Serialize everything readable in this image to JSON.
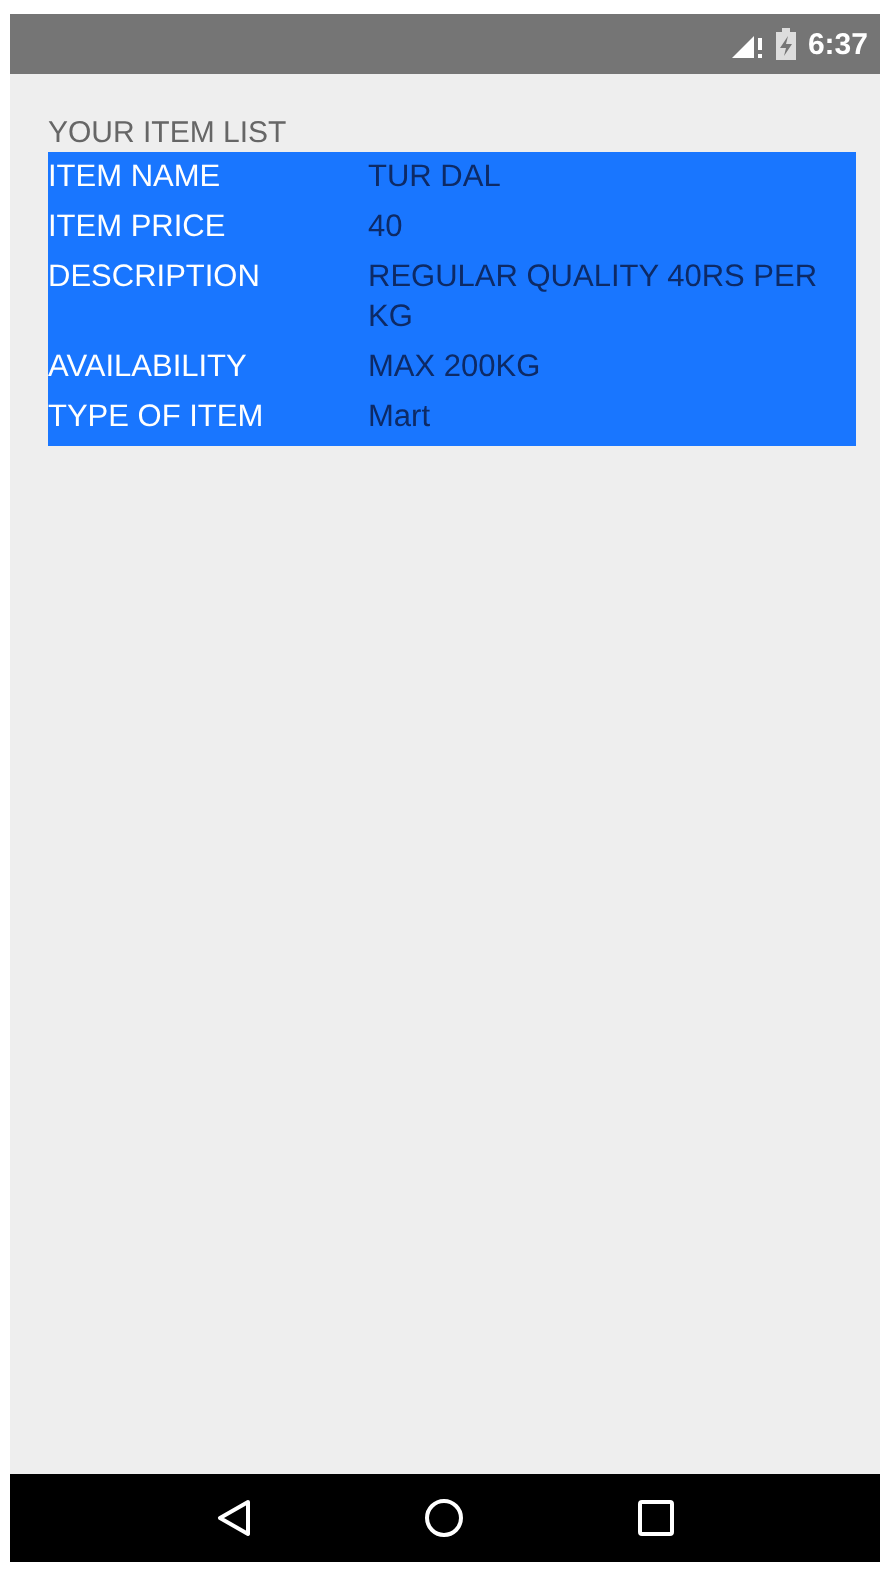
{
  "status_bar": {
    "time": "6:37"
  },
  "heading": "YOUR ITEM LIST",
  "details": [
    {
      "label": "ITEM NAME",
      "value": "TUR DAL"
    },
    {
      "label": "ITEM PRICE",
      "value": "40"
    },
    {
      "label": "DESCRIPTION",
      "value": "REGULAR QUALITY 40RS PER KG"
    },
    {
      "label": "AVAILABILITY",
      "value": "MAX 200KG"
    },
    {
      "label": "TYPE OF ITEM",
      "value": "Mart"
    }
  ]
}
